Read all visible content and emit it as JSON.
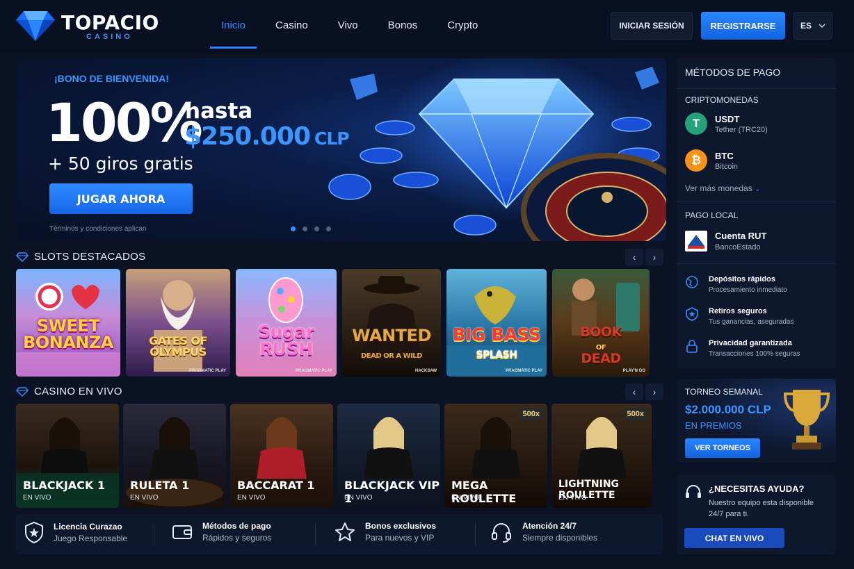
{
  "brand": {
    "name": "TOPACIO",
    "sub": "CASINO"
  },
  "nav": [
    {
      "label": "Inicio",
      "active": true
    },
    {
      "label": "Casino"
    },
    {
      "label": "Vivo"
    },
    {
      "label": "Bonos"
    },
    {
      "label": "Crypto"
    }
  ],
  "header": {
    "login": "INICIAR SESIÓN",
    "register": "REGISTRARSE",
    "lang": "ES"
  },
  "hero": {
    "kicker": "¡BONO DE BIENVENIDA!",
    "percent": "100%",
    "hasta": "hasta",
    "amount": "$250.000",
    "currency": "CLP",
    "spins": "+ 50 giros gratis",
    "cta": "JUGAR AHORA",
    "terms": "Términos y condiciones aplican",
    "slides": 4,
    "active_slide": 1
  },
  "slots": {
    "title": "SLOTS DESTACADOS",
    "items": [
      {
        "title_lines": [
          "SWEET",
          "BONANZA"
        ],
        "provider": ""
      },
      {
        "title_lines": [
          "GATES OF",
          "OLYMPUS"
        ],
        "provider": "PRAGMATIC PLAY"
      },
      {
        "title_lines": [
          "Sugar",
          "RUSH"
        ],
        "provider": "PRAGMATIC PLAY"
      },
      {
        "title_lines": [
          "WANTED",
          "DEAD OR A WILD"
        ],
        "provider": "HACKSAW"
      },
      {
        "title_lines": [
          "BIG BASS",
          "SPLASH"
        ],
        "provider": "PRAGMATIC PLAY"
      },
      {
        "title_lines": [
          "BOOK",
          "OF",
          "DEAD"
        ],
        "provider": "PLAY'N GO"
      }
    ]
  },
  "live": {
    "title": "CASINO EN VIVO",
    "items": [
      {
        "name": "BLACKJACK 1",
        "status": "EN VIVO",
        "badge": ""
      },
      {
        "name": "RULETA 1",
        "status": "EN VIVO",
        "badge": ""
      },
      {
        "name": "BACCARAT 1",
        "status": "EN VIVO",
        "badge": ""
      },
      {
        "name": "BLACKJACK VIP 1",
        "status": "EN VIVO",
        "badge": ""
      },
      {
        "name": "MEGA ROULETTE",
        "status": "EN VIVO",
        "badge": "500x"
      },
      {
        "name": "LIGHTNING ROULETTE",
        "status": "EN VIVO",
        "badge": "500x"
      }
    ]
  },
  "features": [
    {
      "title": "Licencia Curazao",
      "sub": "Juego Responsable",
      "icon": "shield-star-icon"
    },
    {
      "title": "Métodos de pago",
      "sub": "Rápidos y seguros",
      "icon": "wallet-icon"
    },
    {
      "title": "Bonos exclusivos",
      "sub": "Para nuevos y VIP",
      "icon": "star-icon"
    },
    {
      "title": "Atención 24/7",
      "sub": "Siempre disponibles",
      "icon": "headset-icon"
    }
  ],
  "payments": {
    "title": "MÉTODOS DE PAGO",
    "crypto_label": "CRIPTOMONEDAS",
    "coins": [
      {
        "name": "USDT",
        "sub": "Tether (TRC20)",
        "symbol": "T",
        "color": "#26a17b"
      },
      {
        "name": "BTC",
        "sub": "Bitcoin",
        "symbol": "₿",
        "color": "#f7931a"
      }
    ],
    "more": "Ver más monedas",
    "local_label": "PAGO LOCAL",
    "local": {
      "name": "Cuenta RUT",
      "sub": "BancoEstado"
    },
    "perks": [
      {
        "title": "Depósitos rápidos",
        "sub": "Procesamiento inmediato",
        "icon": "globe-icon"
      },
      {
        "title": "Retiros seguros",
        "sub": "Tus ganancias, aseguradas",
        "icon": "shield-icon"
      },
      {
        "title": "Privacidad garantizada",
        "sub": "Transacciones 100% seguras",
        "icon": "lock-icon"
      }
    ]
  },
  "tournament": {
    "label": "TORNEO SEMANAL",
    "amount": "$2.000.000 CLP",
    "prize": "EN PREMIOS",
    "cta": "VER TORNEOS"
  },
  "help": {
    "title": "¿NECESITAS AYUDA?",
    "text": "Nuestro equipo esta disponible 24/7 para ti.",
    "cta": "CHAT EN VIVO"
  },
  "colors": {
    "accent": "#2f80ff",
    "bg": "#0a1224",
    "panel": "#0d172d"
  }
}
